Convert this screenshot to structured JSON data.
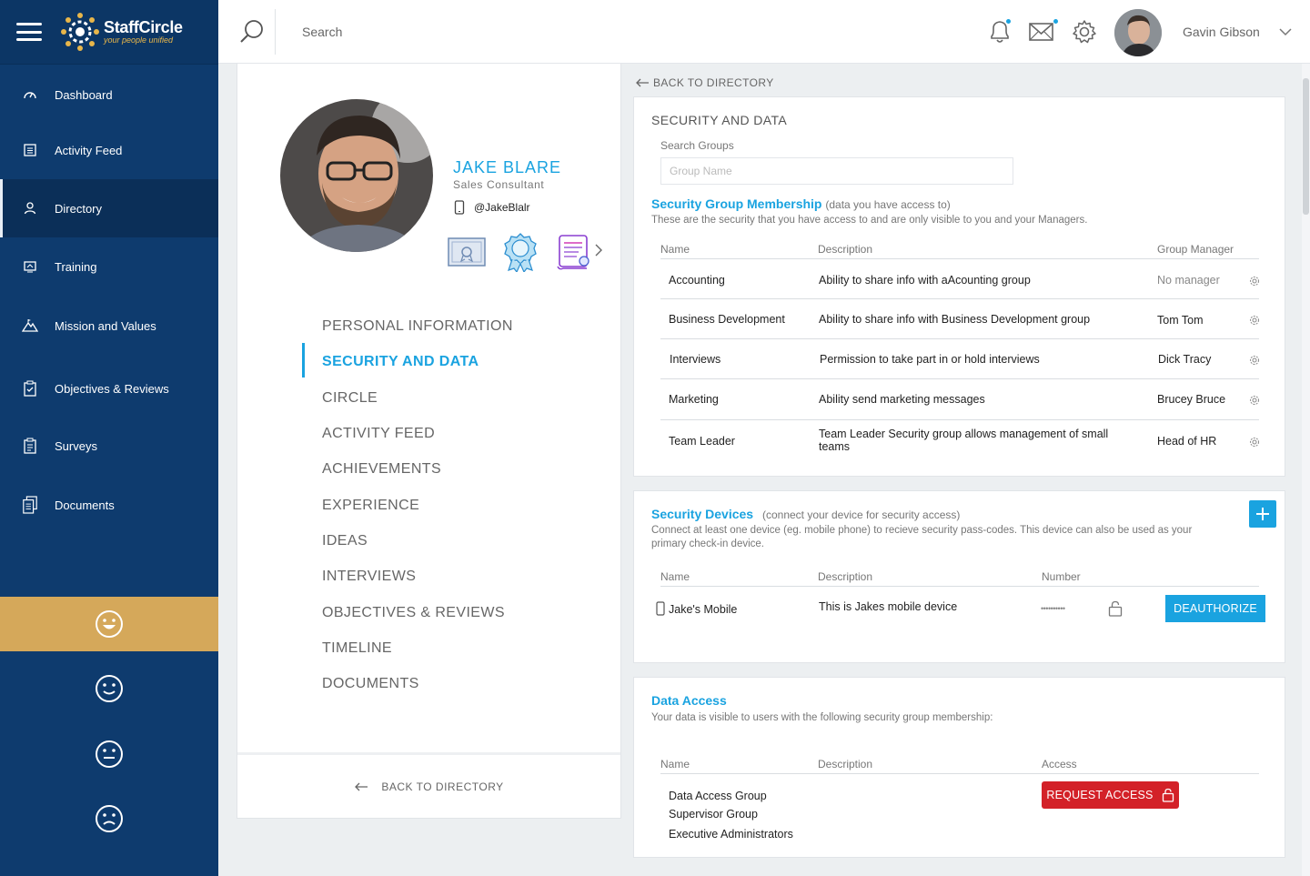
{
  "app": {
    "logo_name": "StaffCircle",
    "logo_tagline": "your people unified"
  },
  "sidebar": {
    "items": [
      {
        "label": "Dashboard",
        "icon": "dashboard-icon"
      },
      {
        "label": "Activity Feed",
        "icon": "activity-feed-icon"
      },
      {
        "label": "Directory",
        "icon": "directory-icon",
        "active": true
      },
      {
        "label": "Training",
        "icon": "training-icon"
      },
      {
        "label": "Mission and Values",
        "icon": "mission-icon"
      },
      {
        "label": "Objectives & Reviews",
        "icon": "objectives-icon"
      },
      {
        "label": "Surveys",
        "icon": "surveys-icon"
      },
      {
        "label": "Documents",
        "icon": "documents-icon"
      }
    ],
    "moods": [
      "very-happy-icon",
      "happy-icon",
      "neutral-icon",
      "sad-icon"
    ],
    "active_mood": 0,
    "colors": {
      "bg": "#0e3b6e",
      "mood_active": "#d5a85a"
    }
  },
  "topbar": {
    "search_placeholder": "Search",
    "user_name": "Gavin Gibson"
  },
  "profile": {
    "name": "JAKE BLARE",
    "title": "Sales Consultant",
    "handle": "@JakeBlalr",
    "menu": [
      "PERSONAL INFORMATION",
      "SECURITY AND DATA",
      "CIRCLE",
      "ACTIVITY FEED",
      "ACHIEVEMENTS",
      "EXPERIENCE",
      "IDEAS",
      "INTERVIEWS",
      "OBJECTIVES & REVIEWS",
      "TIMELINE",
      "DOCUMENTS"
    ],
    "active_menu": 1,
    "back_label": "BACK TO DIRECTORY"
  },
  "main": {
    "back_label": "BACK TO DIRECTORY",
    "security": {
      "title": "SECURITY AND DATA",
      "search_label": "Search Groups",
      "search_placeholder": "Group Name",
      "membership_heading": "Security Group Membership",
      "membership_note": "(data you have access to)",
      "membership_desc": "These are the security that you have access to and are only visible to you and your Managers.",
      "columns": [
        "Name",
        "Description",
        "Group Manager"
      ],
      "rows": [
        {
          "name": "Accounting",
          "description": "Ability to share info with aAcounting group",
          "manager": "No manager"
        },
        {
          "name": "Business Development",
          "description": "Ability to share info with Business Development group",
          "manager": "Tom Tom"
        },
        {
          "name": "Interviews",
          "description": "Permission to take part in or hold interviews",
          "manager": "Dick Tracy"
        },
        {
          "name": "Marketing",
          "description": "Ability send marketing messages",
          "manager": "Brucey Bruce"
        },
        {
          "name": "Team Leader",
          "description": "Team Leader Security group allows management of small teams",
          "manager": "Head of HR"
        }
      ]
    },
    "devices": {
      "heading": "Security Devices",
      "note": "(connect your device for security access)",
      "desc": "Connect at least one device (eg. mobile phone) to recieve security pass-codes. This device can also be used as your primary check-in device.",
      "columns": [
        "Name",
        "Description",
        "Number"
      ],
      "rows": [
        {
          "name": "Jake's Mobile",
          "description": "This is Jakes mobile device",
          "number": "••••••••••",
          "action": "DEAUTHORIZE"
        }
      ]
    },
    "data_access": {
      "heading": "Data Access",
      "desc": "Your data is visible to users with the following security group membership:",
      "columns": [
        "Name",
        "Description",
        "Access"
      ],
      "groups": [
        "Data Access Group",
        "Supervisor Group",
        "Executive Administrators"
      ],
      "action": "REQUEST ACCESS"
    }
  },
  "colors": {
    "accent": "#1aa3e0",
    "danger": "#d32128",
    "gold": "#e8b64a"
  }
}
